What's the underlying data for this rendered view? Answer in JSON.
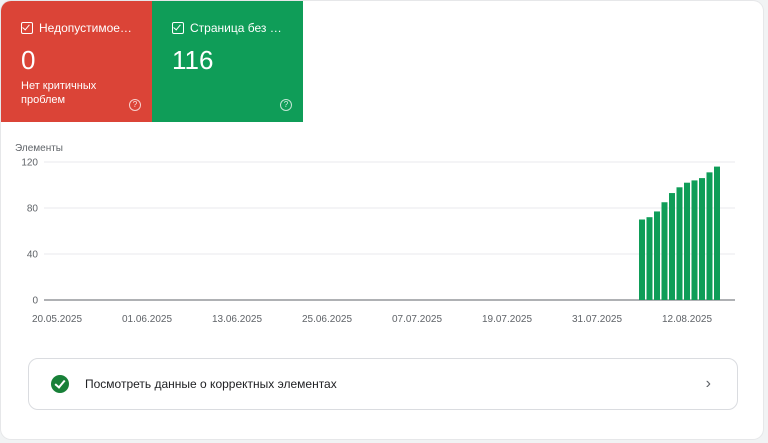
{
  "tiles": {
    "invalid": {
      "title": "Недопустимое з...",
      "value": "0",
      "subtitle": "Нет критичных проблем",
      "color": "#db4437",
      "icon": "checkbox-checked-icon",
      "help_icon": "help-circle-icon"
    },
    "valid": {
      "title": "Страница без ош...",
      "value": "116",
      "color": "#0f9d58",
      "icon": "checkbox-checked-icon",
      "help_icon": "help-circle-icon"
    }
  },
  "chart_data": {
    "type": "bar",
    "ylabel": "Элементы",
    "ylim": [
      0,
      120
    ],
    "yticks": [
      0,
      40,
      80,
      120
    ],
    "xticks": [
      "20.05.2025",
      "01.06.2025",
      "13.06.2025",
      "25.06.2025",
      "07.07.2025",
      "19.07.2025",
      "31.07.2025",
      "12.08.2025"
    ],
    "x_start": "20.05.2025",
    "grid": true,
    "series": [
      {
        "color": "#0f9d58",
        "points": [
          {
            "x": "06.08.2025",
            "y": 70
          },
          {
            "x": "07.08.2025",
            "y": 72
          },
          {
            "x": "08.08.2025",
            "y": 77
          },
          {
            "x": "09.08.2025",
            "y": 85
          },
          {
            "x": "10.08.2025",
            "y": 93
          },
          {
            "x": "11.08.2025",
            "y": 98
          },
          {
            "x": "12.08.2025",
            "y": 102
          },
          {
            "x": "13.08.2025",
            "y": 104
          },
          {
            "x": "14.08.2025",
            "y": 106
          },
          {
            "x": "15.08.2025",
            "y": 111
          },
          {
            "x": "16.08.2025",
            "y": 116
          }
        ]
      }
    ]
  },
  "link_panel": {
    "label": "Посмотреть данные о корректных элементах",
    "icon": "check-circle-icon",
    "chevron": "chevron-right-icon"
  }
}
